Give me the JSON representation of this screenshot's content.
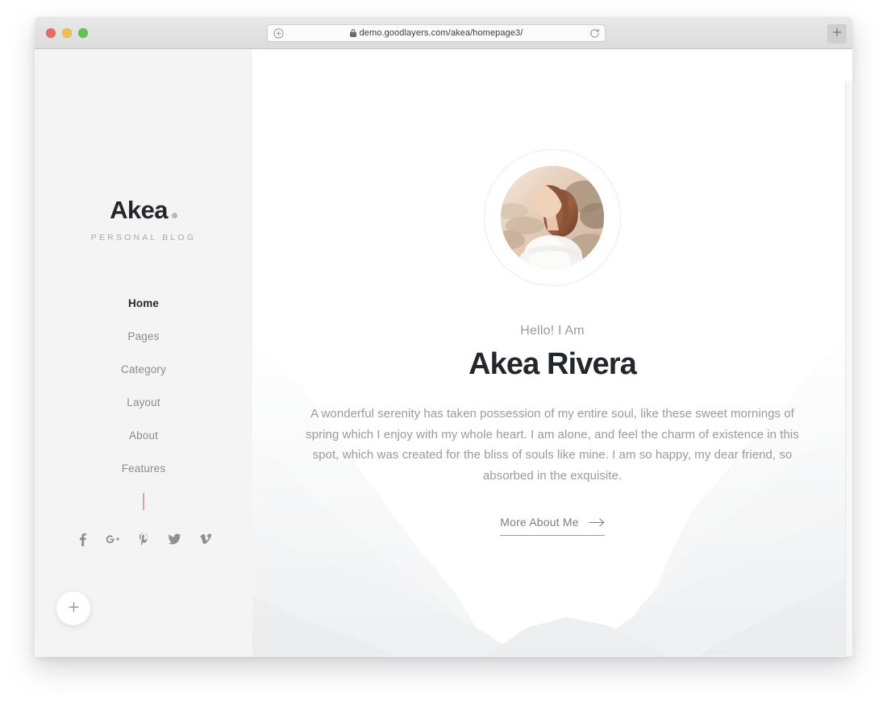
{
  "browser": {
    "traffic_lights": [
      {
        "name": "close",
        "color": "#ec6a5f"
      },
      {
        "name": "minimize",
        "color": "#f4bd4f"
      },
      {
        "name": "maximize",
        "color": "#61c454"
      }
    ],
    "url": "demo.goodlayers.com/akea/homepage3/",
    "url_secure": true,
    "add_site_icon": "plus-circle-icon",
    "reload_icon": "reload-icon",
    "new_tab_icon": "plus-icon"
  },
  "sidebar": {
    "brand": {
      "title": "Akea",
      "dot_color": "#b6b6b6",
      "tagline": "PERSONAL BLOG"
    },
    "nav": [
      {
        "label": "Home",
        "active": true
      },
      {
        "label": "Pages",
        "active": false
      },
      {
        "label": "Category",
        "active": false
      },
      {
        "label": "Layout",
        "active": false
      },
      {
        "label": "About",
        "active": false
      },
      {
        "label": "Features",
        "active": false
      }
    ],
    "divider_color": "#d8a598",
    "socials": [
      {
        "name": "facebook-icon",
        "label": "f"
      },
      {
        "name": "googleplus-icon",
        "label": "G+"
      },
      {
        "name": "pinterest-icon",
        "label": "P"
      },
      {
        "name": "twitter-icon",
        "label": "t"
      },
      {
        "name": "vimeo-icon",
        "label": "v"
      }
    ],
    "fab": {
      "icon": "plus-icon",
      "label": "+"
    },
    "background_color": "#f4f4f4"
  },
  "hero": {
    "avatar_alt": "portrait of woman in white off-shoulder top on a beach",
    "greeting": "Hello! I Am",
    "name": "Akea Rivera",
    "description": "A wonderful serenity has taken possession of my entire soul, like these sweet mornings of spring which I enjoy with my whole heart. I am alone, and feel the charm of existence in this spot, which was created for the bliss of souls like mine. I am so happy, my dear friend, so absorbed in the exquisite.",
    "cta_label": "More About Me",
    "cta_icon": "arrow-right-icon",
    "heading_color": "#23262b",
    "muted_color": "#9a9a9a"
  }
}
